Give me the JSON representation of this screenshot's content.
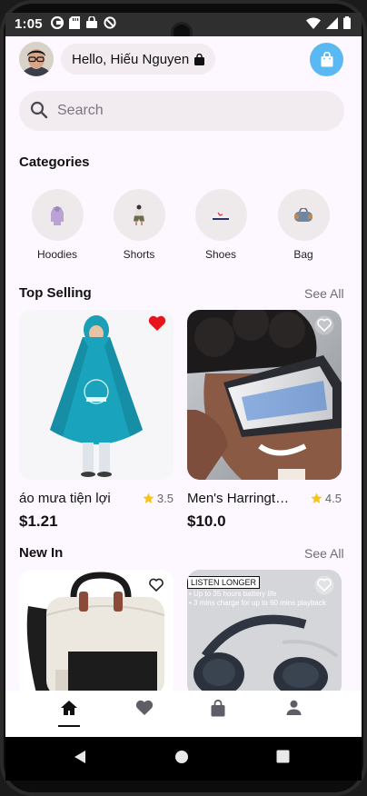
{
  "status_bar": {
    "time": "1:05"
  },
  "header": {
    "greeting": "Hello, Hiếu Nguyen",
    "avatar_icon": "user-avatar",
    "cart_icon": "shopping-bag-icon"
  },
  "search": {
    "placeholder": "Search"
  },
  "categories": {
    "title": "Categories",
    "items": [
      {
        "label": "Hoodies",
        "icon": "hoodie-thumbnail"
      },
      {
        "label": "Shorts",
        "icon": "shorts-thumbnail"
      },
      {
        "label": "Shoes",
        "icon": "shoes-thumbnail"
      },
      {
        "label": "Bag",
        "icon": "bag-thumbnail"
      }
    ]
  },
  "top_selling": {
    "title": "Top Selling",
    "see_all": "See All",
    "products": [
      {
        "name": "áo mưa tiện lợi",
        "rating": "3.5",
        "price": "$1.21",
        "favorited": true
      },
      {
        "name": "Men's Harrington Jacket",
        "rating": "4.5",
        "price": "$10.0",
        "favorited": false
      }
    ]
  },
  "new_in": {
    "title": "New In",
    "see_all": "See All",
    "products": [
      {
        "image_text": "",
        "favorited": false
      },
      {
        "image_text": "LISTEN LONGER",
        "bullet1": "• Up to 35 hours battery life",
        "bullet2": "• 3 mins charge for up to 60 mins playback",
        "favorited": false
      }
    ]
  },
  "colors": {
    "accent": "#5ab9f2",
    "favorite": "#e8141c",
    "star": "#f5c518",
    "surface": "#fdf7ff"
  }
}
